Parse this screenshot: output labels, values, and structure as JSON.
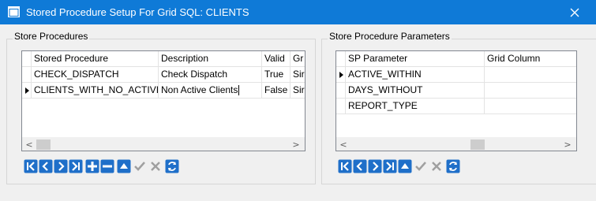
{
  "window": {
    "title": "Stored Procedure Setup For Grid SQL: CLIENTS",
    "title_bar_color": "#0f7ad7"
  },
  "procedures_panel": {
    "group_title": "Store Procedures",
    "columns": [
      "Stored Procedure",
      "Description",
      "Valid",
      "Gr"
    ],
    "rows": [
      {
        "stored_procedure": "CHECK_DISPATCH",
        "description": "Check Dispatch",
        "valid": "True",
        "grid": "Sir"
      },
      {
        "stored_procedure": "CLIENTS_WITH_NO_ACTIVITY",
        "description": "Non Active Clients",
        "valid": "False",
        "grid": "Sir"
      }
    ],
    "current_row_index": 1,
    "navigator_buttons": [
      "first-icon",
      "prior-icon",
      "next-icon",
      "last-icon",
      "insert-icon",
      "delete-icon",
      "move-up-icon",
      "post-icon",
      "cancel-icon",
      "refresh-icon"
    ]
  },
  "parameters_panel": {
    "group_title": "Store Procedure Parameters",
    "columns": [
      "SP Parameter",
      "Grid Column"
    ],
    "rows": [
      {
        "sp_parameter": "ACTIVE_WITHIN",
        "grid_column": ""
      },
      {
        "sp_parameter": "DAYS_WITHOUT",
        "grid_column": ""
      },
      {
        "sp_parameter": "REPORT_TYPE",
        "grid_column": ""
      }
    ],
    "current_row_index": 0,
    "navigator_buttons": [
      "first-icon",
      "prior-icon",
      "next-icon",
      "last-icon",
      "move-up-icon",
      "post-icon",
      "cancel-icon",
      "refresh-icon"
    ]
  },
  "colors": {
    "nav_icon_enabled": "#1f6fc9",
    "nav_icon_disabled": "#a0a0a0"
  }
}
